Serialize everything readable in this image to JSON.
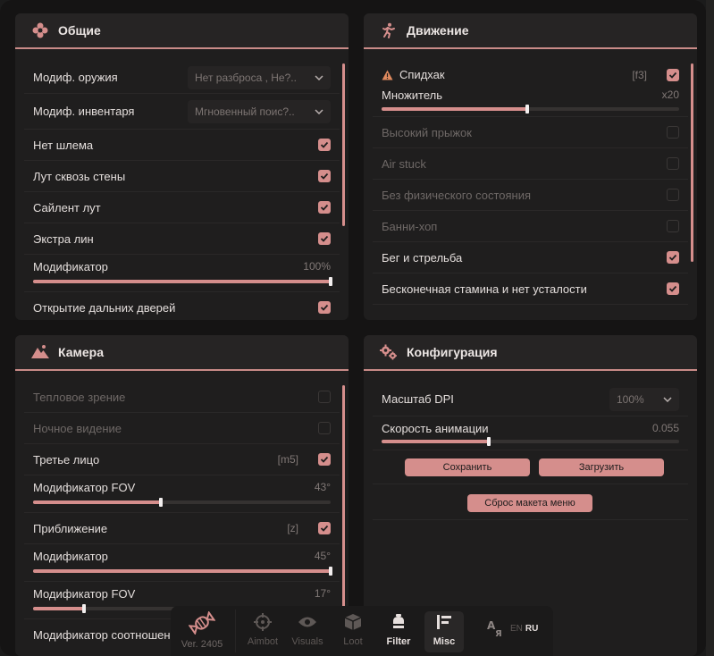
{
  "colors": {
    "accent": "#d58e8c",
    "panel": "#1f1e1e",
    "background": "#151414",
    "text": "#e4dedc",
    "dim_text": "#6e6866"
  },
  "general": {
    "title": "Общие",
    "icon": "flower-icon",
    "weapon_mod": {
      "label": "Модиф. оружия",
      "value": "Нет разброса , Не?.."
    },
    "inventory_mod": {
      "label": "Модиф. инвентаря",
      "value": "Мгновенный поис?.."
    },
    "items": [
      {
        "label": "Нет шлема",
        "checked": true
      },
      {
        "label": "Лут сквозь стены",
        "checked": true
      },
      {
        "label": "Сайлент лут",
        "checked": true
      },
      {
        "label": "Экстра лин",
        "checked": true
      }
    ],
    "modifier": {
      "label": "Модификатор",
      "value": "100%",
      "fraction": 1.0
    },
    "doors": {
      "label": "Открытие дальних дверей",
      "checked": true
    }
  },
  "movement": {
    "title": "Движение",
    "icon": "running-man-icon",
    "speedhack": {
      "label": "Спидхак",
      "key": "[f3]",
      "checked": true
    },
    "multiplier": {
      "label": "Множитель",
      "value": "x20",
      "fraction": 0.49
    },
    "items": [
      {
        "label": "Высокий прыжок",
        "checked": false,
        "dim": true
      },
      {
        "label": "Air stuck",
        "checked": false,
        "dim": true
      },
      {
        "label": "Без физического состояния",
        "checked": false,
        "dim": true
      },
      {
        "label": "Банни-хоп",
        "checked": false,
        "dim": true
      },
      {
        "label": "Бег и стрельба",
        "checked": true,
        "dim": false
      },
      {
        "label": "Бесконечная стамина и нет усталости",
        "checked": true,
        "dim": false
      }
    ]
  },
  "camera": {
    "title": "Камера",
    "icon": "mountain-icon",
    "thermal": {
      "label": "Тепловое зрение",
      "checked": false
    },
    "night": {
      "label": "Ночное видение",
      "checked": false
    },
    "third_person": {
      "label": "Третье лицо",
      "key": "[m5]",
      "checked": true
    },
    "fov1": {
      "label": "Модификатор FOV",
      "value": "43°",
      "fraction": 0.43
    },
    "zoom": {
      "label": "Приближение",
      "key": "[z]",
      "checked": true
    },
    "mod2": {
      "label": "Модификатор",
      "value": "45°",
      "fraction": 1.0
    },
    "fov2": {
      "label": "Модификатор FOV",
      "value": "17°",
      "fraction": 0.17
    },
    "aspect": {
      "label": "Модификатор соотношени"
    }
  },
  "config": {
    "title": "Конфигурация",
    "icon": "gears-icon",
    "dpi": {
      "label": "Масштаб DPI",
      "value": "100%"
    },
    "anim": {
      "label": "Скорость анимации",
      "value": "0.055",
      "fraction": 0.36
    },
    "save": "Сохранить",
    "load": "Загрузить",
    "reset": "Сброс макета меню"
  },
  "dock": {
    "version": "Ver. 2405",
    "tabs": [
      {
        "label": "Aimbot",
        "icon": "crosshair-icon"
      },
      {
        "label": "Visuals",
        "icon": "eye-icon"
      },
      {
        "label": "Loot",
        "icon": "box-icon"
      },
      {
        "label": "Filter",
        "icon": "filter-icon"
      },
      {
        "label": "Misc",
        "icon": "misc-icon"
      }
    ],
    "lang_en": "EN",
    "lang_ru": "RU"
  }
}
